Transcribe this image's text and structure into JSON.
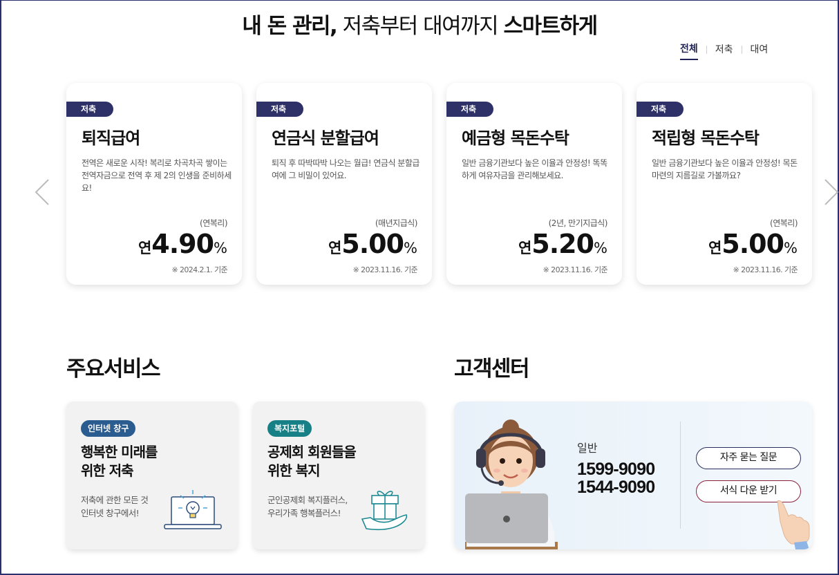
{
  "headline": {
    "part1": "내 돈 관리,",
    "part2": " 저축부터 대여까지 ",
    "part3": "스마트하게"
  },
  "tabs": [
    "전체",
    "저축",
    "대여"
  ],
  "products": [
    {
      "badge": "저축",
      "title": "퇴직급여",
      "desc": "전역은 새로운 시작! 복리로 차곡차곡 쌓이는 전역자금으로 전역 후 제 2의 인생을 준비하세요!",
      "note": "(연복리)",
      "prefix": "연",
      "rate": "4.90",
      "unit": "%",
      "basis": "※ 2024.2.1. 기준"
    },
    {
      "badge": "저축",
      "title": "연금식 분할급여",
      "desc": "퇴직 후 따박따박 나오는 월급! 연금식 분할급여에 그 비밀이 있어요.",
      "note": "(매년지급식)",
      "prefix": "연",
      "rate": "5.00",
      "unit": "%",
      "basis": "※ 2023.11.16. 기준"
    },
    {
      "badge": "저축",
      "title": "예금형 목돈수탁",
      "desc": "일반 금융기관보다 높은 이율과 안정성! 똑똑하게 여유자금을 관리해보세요.",
      "note": "(2년, 만기지급식)",
      "prefix": "연",
      "rate": "5.20",
      "unit": "%",
      "basis": "※ 2023.11.16. 기준"
    },
    {
      "badge": "저축",
      "title": "적립형 목돈수탁",
      "desc": "일반 금융기관보다 높은 이율과 안정성! 목돈 마련의 지름길로 가볼까요?",
      "note": "(연복리)",
      "prefix": "연",
      "rate": "5.00",
      "unit": "%",
      "basis": "※ 2023.11.16. 기준"
    }
  ],
  "services": {
    "title": "주요서비스",
    "items": [
      {
        "pill": "인터넷 창구",
        "pill_color": "#2b5c8f",
        "title_line1": "행복한 미래를",
        "title_line2": "위한 저축",
        "desc_line1": "저축에 관한 모든 것",
        "desc_line2": "인터넷 창구에서!",
        "icon": "laptop-lightbulb-icon"
      },
      {
        "pill": "복지포털",
        "pill_color": "#177f86",
        "title_line1": "공제회 회원들을",
        "title_line2": "위한 복지",
        "desc_line1": "군인공제회 복지플러스,",
        "desc_line2": "우리가족 행복플러스!",
        "icon": "gift-hand-icon"
      }
    ]
  },
  "customer_center": {
    "title": "고객센터",
    "label": "일반",
    "phones": [
      "1599-9090",
      "1544-9090"
    ],
    "faq_button": "자주 묻는 질문",
    "forms_button": "서식 다운 받기"
  },
  "colors": {
    "navy": "#2d3168",
    "forms_border": "#8b1f3a"
  }
}
